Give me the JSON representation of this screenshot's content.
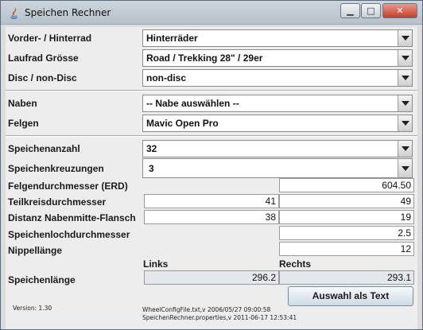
{
  "window": {
    "title": "Speichen Rechner",
    "minimize": "▁",
    "maximize": "□",
    "close": "✕"
  },
  "labels": {
    "vorder_hinterrad": "Vorder- / Hinterrad",
    "laufrad_groesse": "Laufrad Grösse",
    "disc": "Disc / non-Disc",
    "naben": "Naben",
    "felgen": "Felgen",
    "speichenanzahl": "Speichenanzahl",
    "speichenkreuzungen": "Speichenkreuzungen",
    "felgendurchmesser": "Felgendurchmesser (ERD)",
    "teilkreis": "Teilkreisdurchmesser",
    "distanz": "Distanz Nabenmitte-Flansch",
    "speichenloch": "Speichenlochdurchmesser",
    "nippel": "Nippellänge",
    "speichenlaenge": "Speichenlänge",
    "links": "Links",
    "rechts": "Rechts"
  },
  "combos": {
    "vorder_hinterrad": "Hinterräder",
    "laufrad_groesse": "Road / Trekking 28\" / 29er",
    "disc": "non-disc",
    "naben": "-- Nabe auswählen --",
    "felgen": "Mavic Open Pro",
    "speichenanzahl": "32",
    "speichenkreuzungen": "3"
  },
  "fields": {
    "felgendurchmesser": "604.50",
    "teilkreis_links": "41",
    "teilkreis_rechts": "49",
    "distanz_links": "38",
    "distanz_rechts": "19",
    "speichenloch": "2.5",
    "nippel": "12",
    "speichenlaenge_links": "296.2",
    "speichenlaenge_rechts": "293.1"
  },
  "footer": {
    "version": "Version: 1.30",
    "config_line1": "WheelConfigFile.txt,v 2006/05/27 09:00:58",
    "config_line2": "SpeichenRechner.properties,v 2011-06-17 12:53:41",
    "button": "Auswahl als Text"
  }
}
